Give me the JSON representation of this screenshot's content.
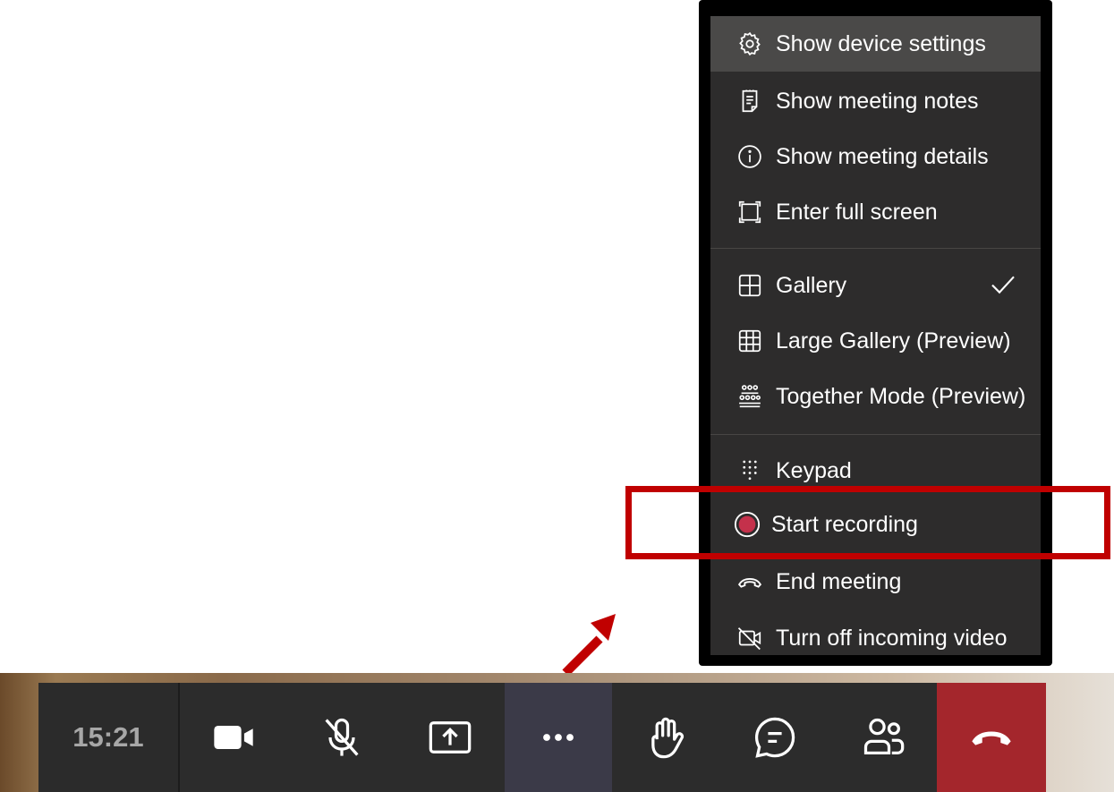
{
  "menu": {
    "items": [
      {
        "label": "Show device settings",
        "icon": "gear-icon",
        "active": true
      },
      {
        "label": "Show meeting notes",
        "icon": "notes-icon"
      },
      {
        "label": "Show meeting details",
        "icon": "info-icon"
      },
      {
        "label": "Enter full screen",
        "icon": "fullscreen-icon"
      },
      {
        "label": "Gallery",
        "icon": "gallery-icon",
        "checked": true
      },
      {
        "label": "Large Gallery (Preview)",
        "icon": "large-gallery-icon"
      },
      {
        "label": "Together Mode (Preview)",
        "icon": "together-mode-icon"
      },
      {
        "label": "Keypad",
        "icon": "keypad-icon"
      },
      {
        "label": "Start recording",
        "icon": "record-icon",
        "highlighted": true
      },
      {
        "label": "End meeting",
        "icon": "end-call-icon"
      },
      {
        "label": "Turn off incoming video",
        "icon": "video-off-icon"
      }
    ]
  },
  "toolbar": {
    "time": "15:21",
    "buttons": [
      {
        "name": "camera-button",
        "icon": "camera-icon"
      },
      {
        "name": "mute-button",
        "icon": "mic-off-icon"
      },
      {
        "name": "share-button",
        "icon": "share-screen-icon"
      },
      {
        "name": "more-actions-button",
        "icon": "more-icon",
        "active": true
      },
      {
        "name": "raise-hand-button",
        "icon": "hand-icon"
      },
      {
        "name": "chat-button",
        "icon": "chat-icon"
      },
      {
        "name": "participants-button",
        "icon": "participants-icon"
      },
      {
        "name": "hang-up-button",
        "icon": "hang-up-icon"
      }
    ]
  },
  "colors": {
    "menu_bg": "#2d2c2c",
    "menu_active": "#4a4948",
    "annotation": "#c00000",
    "record": "#c4314b",
    "hangup": "#a4262c",
    "more_active": "#3b3a48"
  }
}
